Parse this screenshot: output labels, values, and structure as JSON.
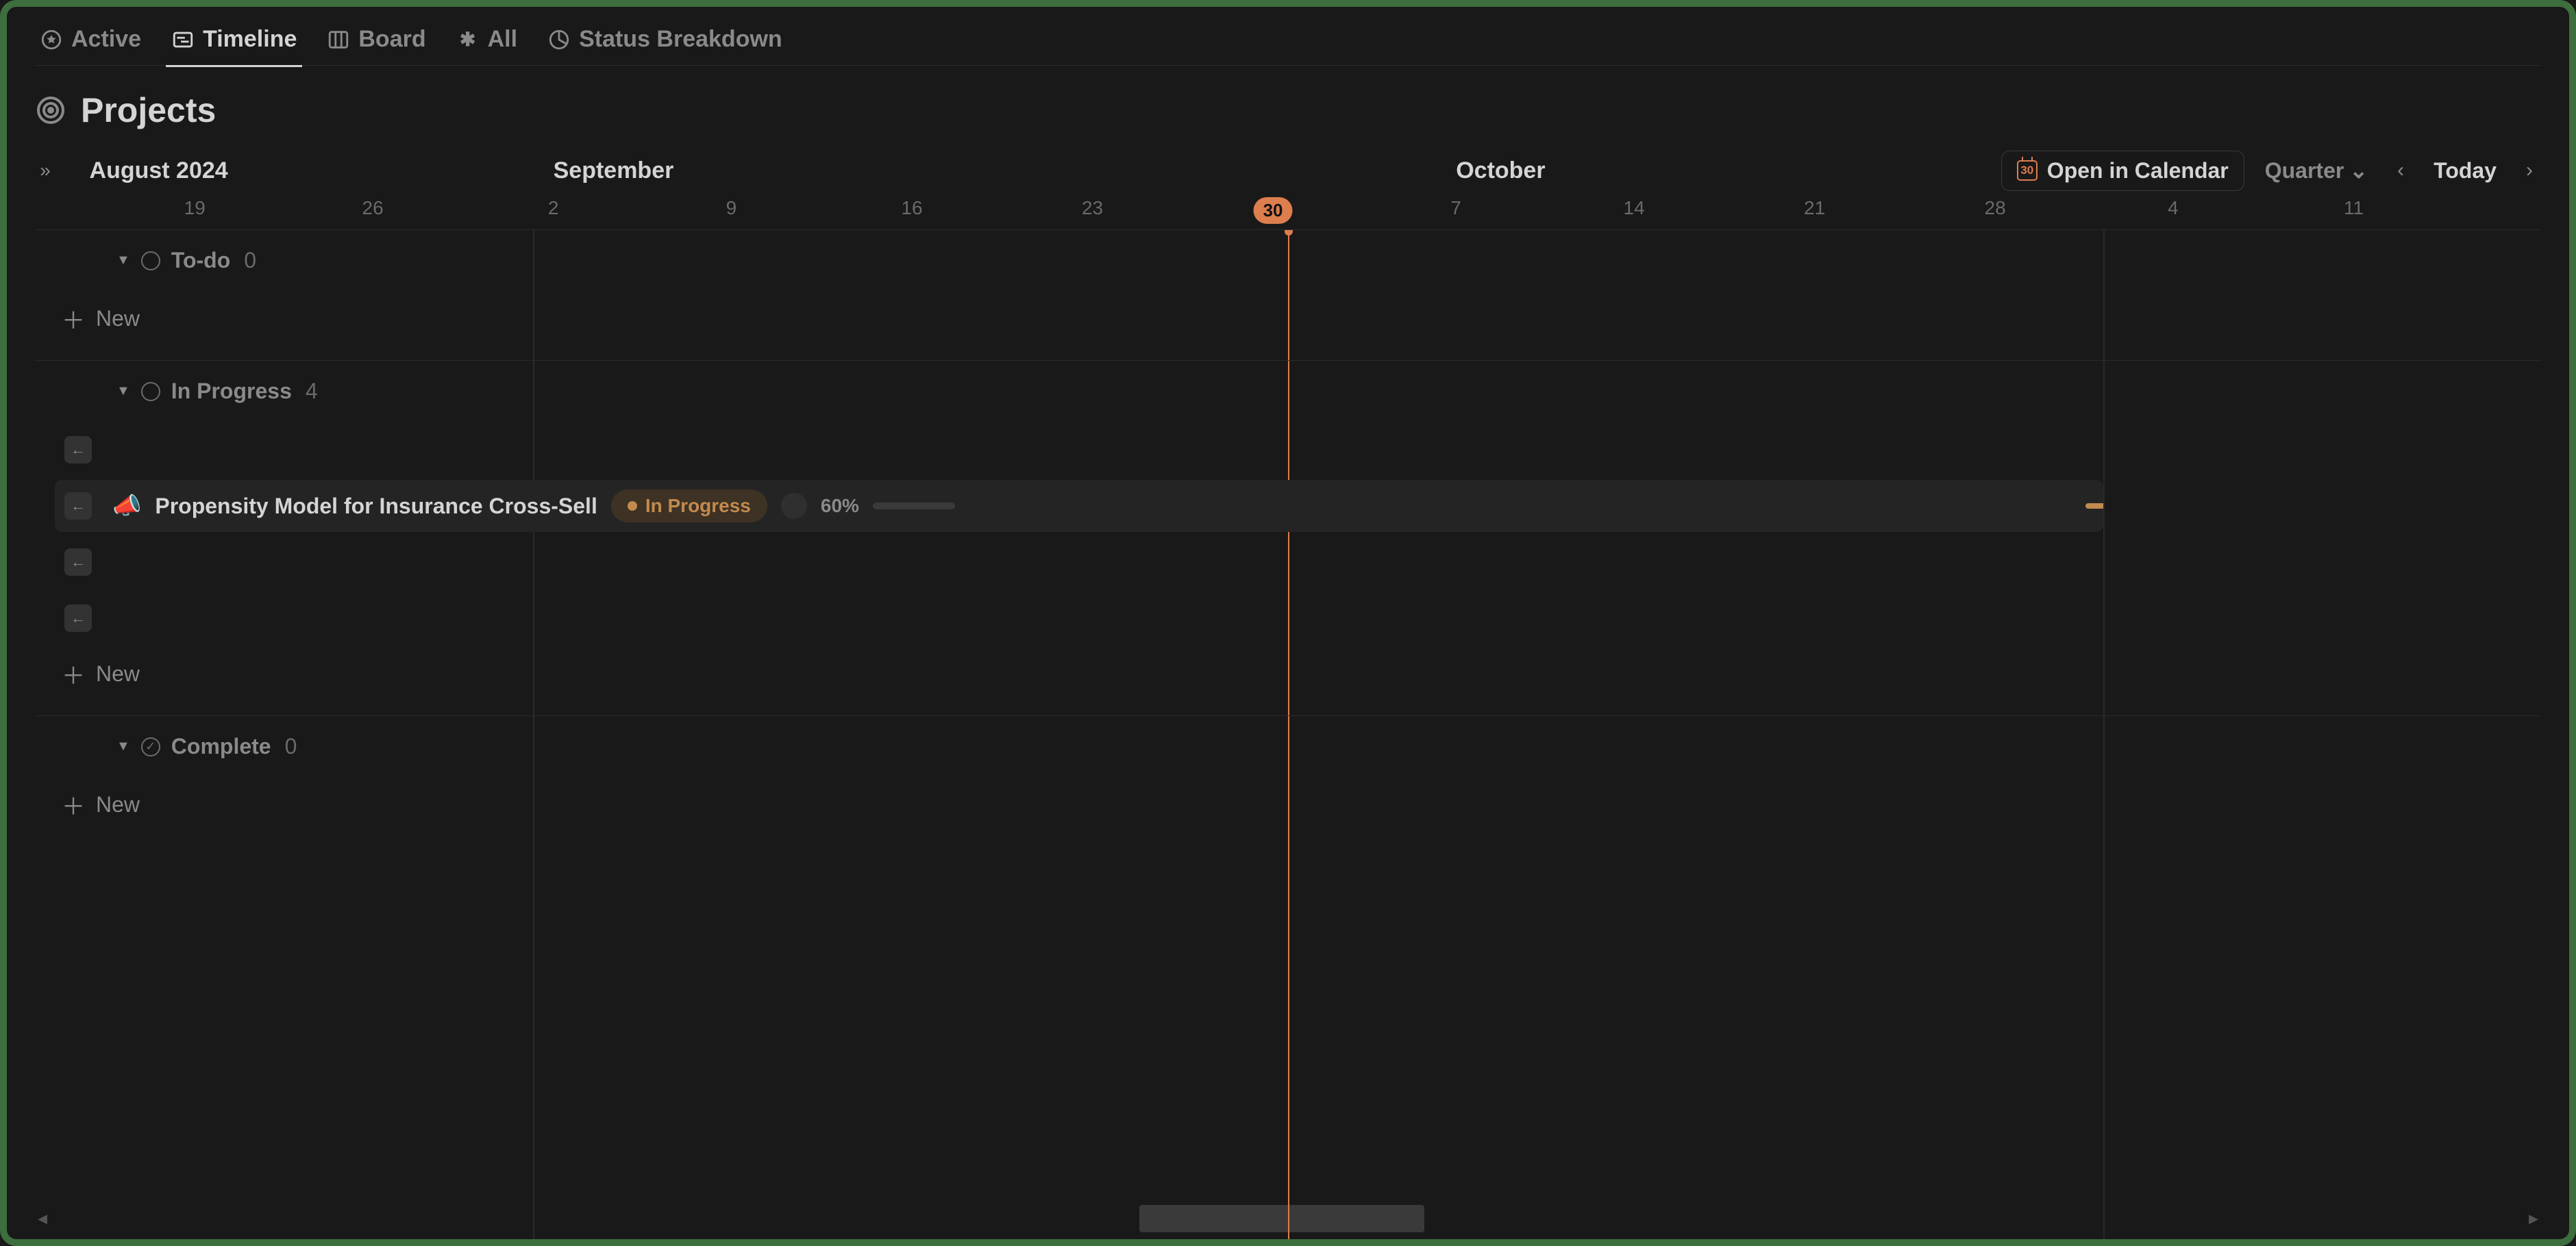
{
  "tabs": [
    {
      "icon": "star-icon",
      "label": "Active"
    },
    {
      "icon": "timeline-icon",
      "label": "Timeline"
    },
    {
      "icon": "board-icon",
      "label": "Board"
    },
    {
      "icon": "sparkle-icon",
      "label": "All"
    },
    {
      "icon": "pie-icon",
      "label": "Status Breakdown"
    }
  ],
  "active_tab": 1,
  "page_title": "Projects",
  "toolbar": {
    "months": [
      {
        "label": "August 2024",
        "pct": 2.2
      },
      {
        "label": "September",
        "pct": 20.7
      },
      {
        "label": "October",
        "pct": 56.7
      }
    ],
    "open_calendar": "Open in Calendar",
    "calendar_day": "30",
    "range": "Quarter",
    "today": "Today"
  },
  "ruler": [
    {
      "label": "19",
      "pct": 6.4
    },
    {
      "label": "26",
      "pct": 13.5
    },
    {
      "label": "2",
      "pct": 20.7
    },
    {
      "label": "9",
      "pct": 27.8
    },
    {
      "label": "16",
      "pct": 35.0
    },
    {
      "label": "23",
      "pct": 42.2
    },
    {
      "label": "30",
      "pct": 49.4,
      "today": true
    },
    {
      "label": "7",
      "pct": 56.7
    },
    {
      "label": "14",
      "pct": 63.8
    },
    {
      "label": "21",
      "pct": 71.0
    },
    {
      "label": "28",
      "pct": 78.2
    },
    {
      "label": "4",
      "pct": 85.3
    },
    {
      "label": "11",
      "pct": 92.5
    }
  ],
  "vlines_pct": [
    19.9,
    82.5
  ],
  "today_line_pct": 50.0,
  "groups": {
    "todo": {
      "label": "To-do",
      "count": "0",
      "new": "New"
    },
    "in_progress": {
      "label": "In Progress",
      "count": "4",
      "new": "New",
      "rows": [
        {
          "type": "arrow"
        },
        {
          "type": "card",
          "emoji": "📣",
          "name": "Propensity Model for Insurance Cross-Sell",
          "status": "In Progress",
          "pct_label": "60%",
          "pct_value": 60,
          "right_pct": 82.5
        },
        {
          "type": "arrow"
        },
        {
          "type": "arrow"
        }
      ]
    },
    "complete": {
      "label": "Complete",
      "count": "0",
      "new": "New"
    }
  },
  "scroll_thumb": {
    "left_pct": 44,
    "width_pct": 11.5
  }
}
